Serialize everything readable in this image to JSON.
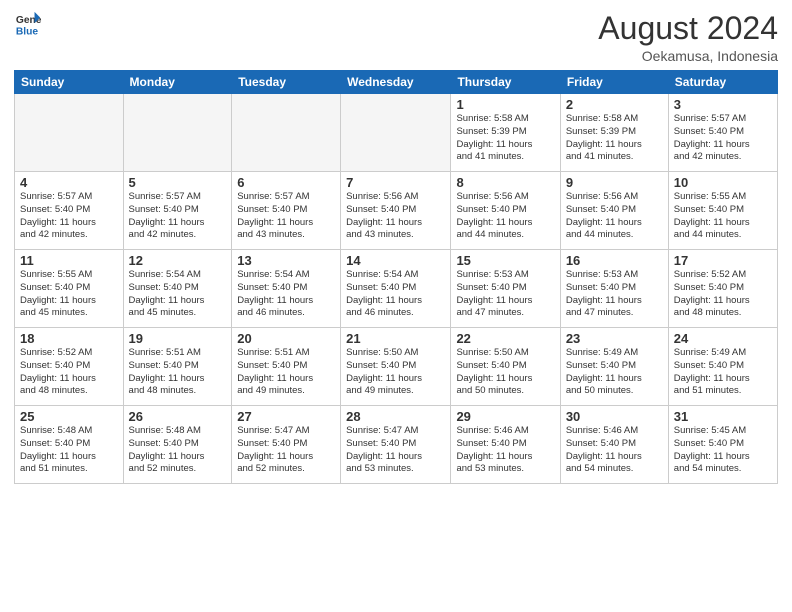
{
  "header": {
    "logo_general": "General",
    "logo_blue": "Blue",
    "month_year": "August 2024",
    "location": "Oekamusa, Indonesia"
  },
  "weekdays": [
    "Sunday",
    "Monday",
    "Tuesday",
    "Wednesday",
    "Thursday",
    "Friday",
    "Saturday"
  ],
  "weeks": [
    [
      {
        "day": "",
        "info": ""
      },
      {
        "day": "",
        "info": ""
      },
      {
        "day": "",
        "info": ""
      },
      {
        "day": "",
        "info": ""
      },
      {
        "day": "1",
        "info": "Sunrise: 5:58 AM\nSunset: 5:39 PM\nDaylight: 11 hours\nand 41 minutes."
      },
      {
        "day": "2",
        "info": "Sunrise: 5:58 AM\nSunset: 5:39 PM\nDaylight: 11 hours\nand 41 minutes."
      },
      {
        "day": "3",
        "info": "Sunrise: 5:57 AM\nSunset: 5:40 PM\nDaylight: 11 hours\nand 42 minutes."
      }
    ],
    [
      {
        "day": "4",
        "info": "Sunrise: 5:57 AM\nSunset: 5:40 PM\nDaylight: 11 hours\nand 42 minutes."
      },
      {
        "day": "5",
        "info": "Sunrise: 5:57 AM\nSunset: 5:40 PM\nDaylight: 11 hours\nand 42 minutes."
      },
      {
        "day": "6",
        "info": "Sunrise: 5:57 AM\nSunset: 5:40 PM\nDaylight: 11 hours\nand 43 minutes."
      },
      {
        "day": "7",
        "info": "Sunrise: 5:56 AM\nSunset: 5:40 PM\nDaylight: 11 hours\nand 43 minutes."
      },
      {
        "day": "8",
        "info": "Sunrise: 5:56 AM\nSunset: 5:40 PM\nDaylight: 11 hours\nand 44 minutes."
      },
      {
        "day": "9",
        "info": "Sunrise: 5:56 AM\nSunset: 5:40 PM\nDaylight: 11 hours\nand 44 minutes."
      },
      {
        "day": "10",
        "info": "Sunrise: 5:55 AM\nSunset: 5:40 PM\nDaylight: 11 hours\nand 44 minutes."
      }
    ],
    [
      {
        "day": "11",
        "info": "Sunrise: 5:55 AM\nSunset: 5:40 PM\nDaylight: 11 hours\nand 45 minutes."
      },
      {
        "day": "12",
        "info": "Sunrise: 5:54 AM\nSunset: 5:40 PM\nDaylight: 11 hours\nand 45 minutes."
      },
      {
        "day": "13",
        "info": "Sunrise: 5:54 AM\nSunset: 5:40 PM\nDaylight: 11 hours\nand 46 minutes."
      },
      {
        "day": "14",
        "info": "Sunrise: 5:54 AM\nSunset: 5:40 PM\nDaylight: 11 hours\nand 46 minutes."
      },
      {
        "day": "15",
        "info": "Sunrise: 5:53 AM\nSunset: 5:40 PM\nDaylight: 11 hours\nand 47 minutes."
      },
      {
        "day": "16",
        "info": "Sunrise: 5:53 AM\nSunset: 5:40 PM\nDaylight: 11 hours\nand 47 minutes."
      },
      {
        "day": "17",
        "info": "Sunrise: 5:52 AM\nSunset: 5:40 PM\nDaylight: 11 hours\nand 48 minutes."
      }
    ],
    [
      {
        "day": "18",
        "info": "Sunrise: 5:52 AM\nSunset: 5:40 PM\nDaylight: 11 hours\nand 48 minutes."
      },
      {
        "day": "19",
        "info": "Sunrise: 5:51 AM\nSunset: 5:40 PM\nDaylight: 11 hours\nand 48 minutes."
      },
      {
        "day": "20",
        "info": "Sunrise: 5:51 AM\nSunset: 5:40 PM\nDaylight: 11 hours\nand 49 minutes."
      },
      {
        "day": "21",
        "info": "Sunrise: 5:50 AM\nSunset: 5:40 PM\nDaylight: 11 hours\nand 49 minutes."
      },
      {
        "day": "22",
        "info": "Sunrise: 5:50 AM\nSunset: 5:40 PM\nDaylight: 11 hours\nand 50 minutes."
      },
      {
        "day": "23",
        "info": "Sunrise: 5:49 AM\nSunset: 5:40 PM\nDaylight: 11 hours\nand 50 minutes."
      },
      {
        "day": "24",
        "info": "Sunrise: 5:49 AM\nSunset: 5:40 PM\nDaylight: 11 hours\nand 51 minutes."
      }
    ],
    [
      {
        "day": "25",
        "info": "Sunrise: 5:48 AM\nSunset: 5:40 PM\nDaylight: 11 hours\nand 51 minutes."
      },
      {
        "day": "26",
        "info": "Sunrise: 5:48 AM\nSunset: 5:40 PM\nDaylight: 11 hours\nand 52 minutes."
      },
      {
        "day": "27",
        "info": "Sunrise: 5:47 AM\nSunset: 5:40 PM\nDaylight: 11 hours\nand 52 minutes."
      },
      {
        "day": "28",
        "info": "Sunrise: 5:47 AM\nSunset: 5:40 PM\nDaylight: 11 hours\nand 53 minutes."
      },
      {
        "day": "29",
        "info": "Sunrise: 5:46 AM\nSunset: 5:40 PM\nDaylight: 11 hours\nand 53 minutes."
      },
      {
        "day": "30",
        "info": "Sunrise: 5:46 AM\nSunset: 5:40 PM\nDaylight: 11 hours\nand 54 minutes."
      },
      {
        "day": "31",
        "info": "Sunrise: 5:45 AM\nSunset: 5:40 PM\nDaylight: 11 hours\nand 54 minutes."
      }
    ]
  ]
}
